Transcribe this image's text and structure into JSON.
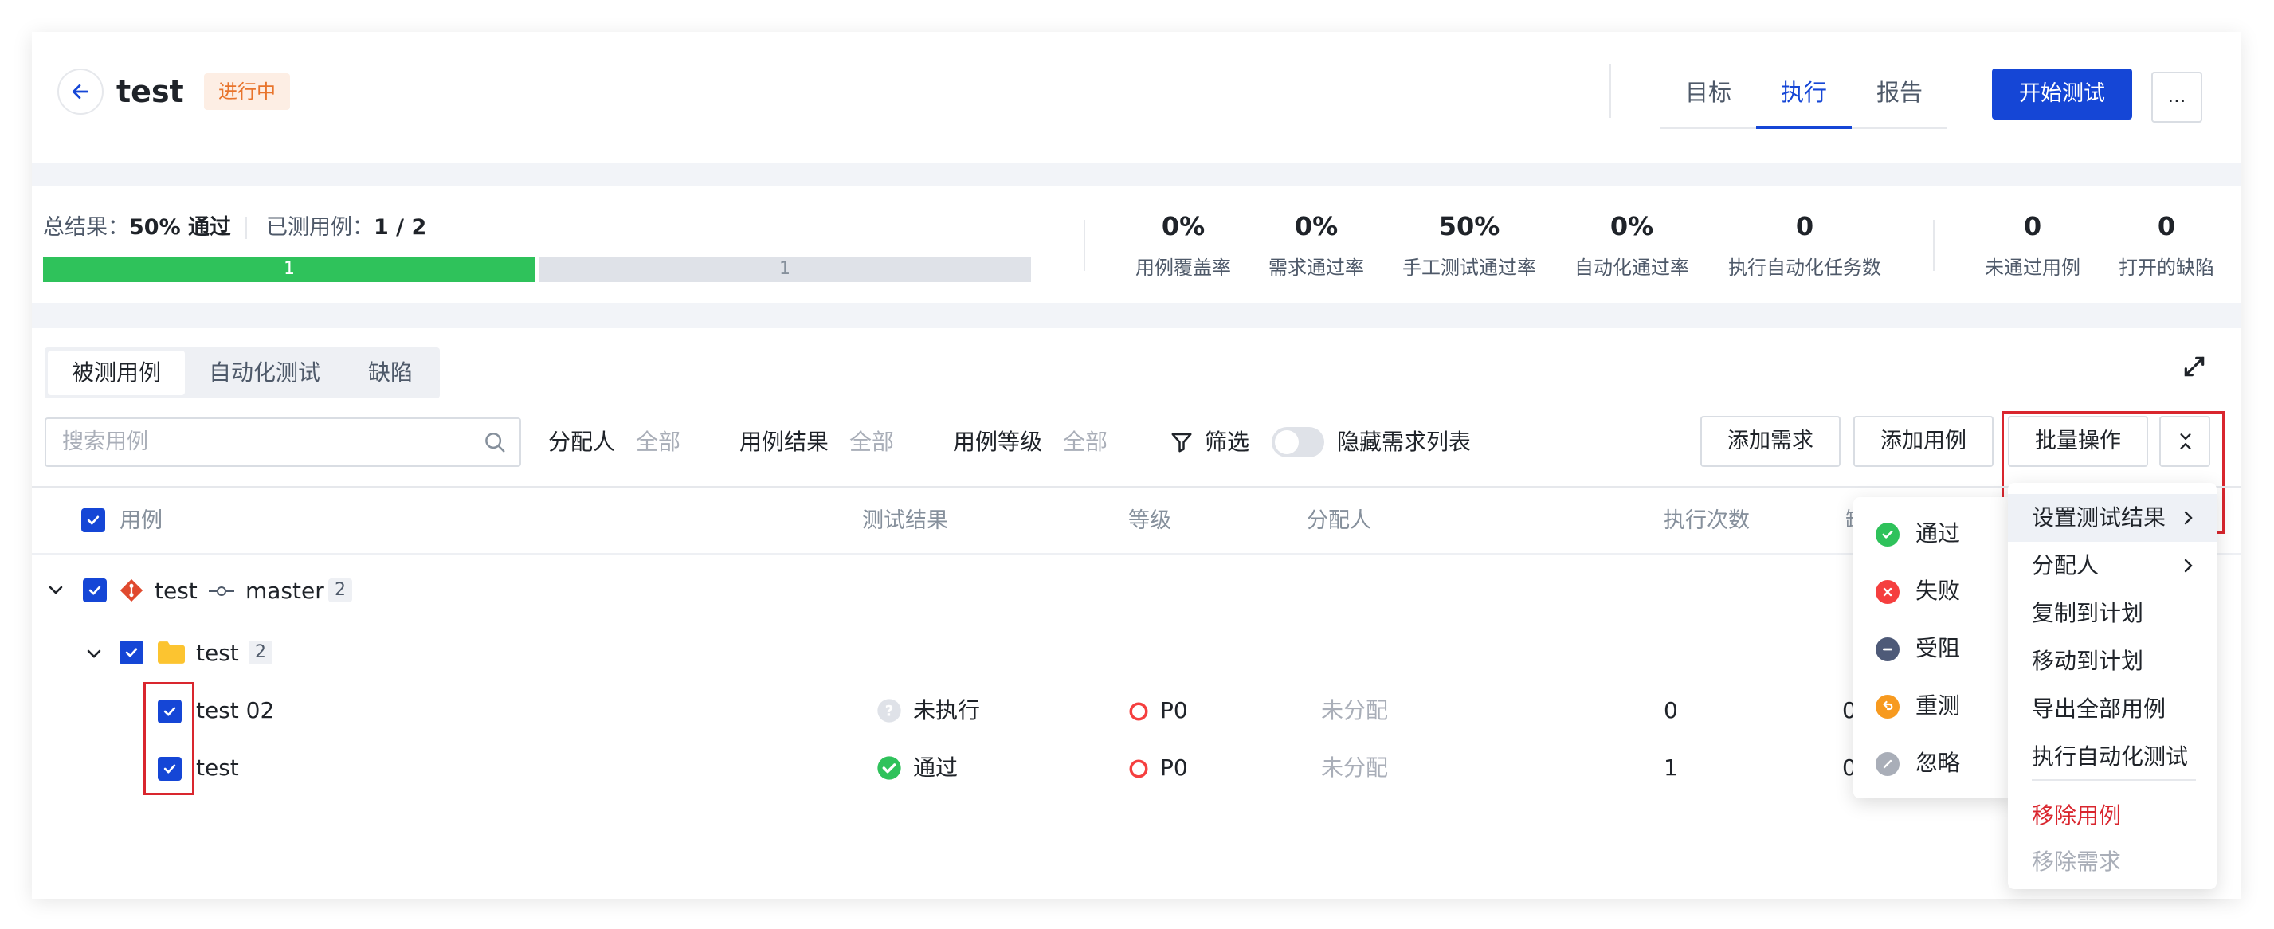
{
  "header": {
    "title": "test",
    "status": "进行中",
    "tabs": [
      {
        "label": "目标",
        "active": false
      },
      {
        "label": "执行",
        "active": true
      },
      {
        "label": "报告",
        "active": false
      }
    ],
    "start_button": "开始测试",
    "more_button": "..."
  },
  "summary": {
    "total_label": "总结果：",
    "total_value": "50% 通过",
    "tested_label": "已测用例：",
    "tested_value": "1 / 2",
    "progress_pass_count": "1",
    "progress_rest_count": "1",
    "progress_pass_fraction": 0.5,
    "colors": {
      "pass": "#2fc25b",
      "rest": "#dfe2e8"
    }
  },
  "metrics": [
    {
      "value": "0%",
      "label": "用例覆盖率"
    },
    {
      "value": "0%",
      "label": "需求通过率"
    },
    {
      "value": "50%",
      "label": "手工测试通过率"
    },
    {
      "value": "0%",
      "label": "自动化通过率"
    },
    {
      "value": "0",
      "label": "执行自动化任务数"
    },
    {
      "value": "0",
      "label": "未通过用例"
    },
    {
      "value": "0",
      "label": "打开的缺陷"
    }
  ],
  "segments": [
    {
      "label": "被测用例",
      "active": true
    },
    {
      "label": "自动化测试",
      "active": false
    },
    {
      "label": "缺陷",
      "active": false
    }
  ],
  "filters": {
    "search_placeholder": "搜索用例",
    "assignee_label": "分配人",
    "assignee_value": "全部",
    "result_label": "用例结果",
    "result_value": "全部",
    "level_label": "用例等级",
    "level_value": "全部",
    "filter_label": "筛选",
    "hide_req_label": "隐藏需求列表"
  },
  "actions": {
    "add_requirement": "添加需求",
    "add_case": "添加用例",
    "batch": "批量操作"
  },
  "table": {
    "headers": {
      "case": "用例",
      "result": "测试结果",
      "level": "等级",
      "assignee": "分配人",
      "exec_count": "执行次数",
      "partial": "缺"
    },
    "repo": {
      "name": "test",
      "branch": "master",
      "count": "2"
    },
    "folder": {
      "name": "test",
      "count": "2"
    },
    "rows": [
      {
        "name": "test 02",
        "result": "未执行",
        "level": "P0",
        "assignee": "未分配",
        "exec_count": "0",
        "extra": "0"
      },
      {
        "name": "test",
        "result": "通过",
        "level": "P0",
        "assignee": "未分配",
        "exec_count": "1",
        "extra": "0"
      }
    ]
  },
  "batch_menu": {
    "items": [
      {
        "label": "设置测试结果",
        "submenu": true
      },
      {
        "label": "分配人",
        "submenu": true
      },
      {
        "label": "复制到计划"
      },
      {
        "label": "移动到计划"
      },
      {
        "label": "导出全部用例"
      },
      {
        "label": "执行自动化测试"
      },
      {
        "label": "移除用例",
        "color": "#d9262e"
      },
      {
        "label": "移除需求",
        "color": "#a9aeb8"
      }
    ]
  },
  "result_submenu": {
    "items": [
      {
        "label": "通过",
        "color": "#2fc25b",
        "icon": "check-circle-icon"
      },
      {
        "label": "失败",
        "color": "#f53f3f",
        "icon": "x-circle-icon"
      },
      {
        "label": "受阻",
        "color": "#4e5a78",
        "icon": "minus-circle-icon"
      },
      {
        "label": "重测",
        "color": "#f79a1f",
        "icon": "undo-circle-icon"
      },
      {
        "label": "忽略",
        "color": "#a9aeb8",
        "icon": "slash-circle-icon"
      }
    ]
  }
}
